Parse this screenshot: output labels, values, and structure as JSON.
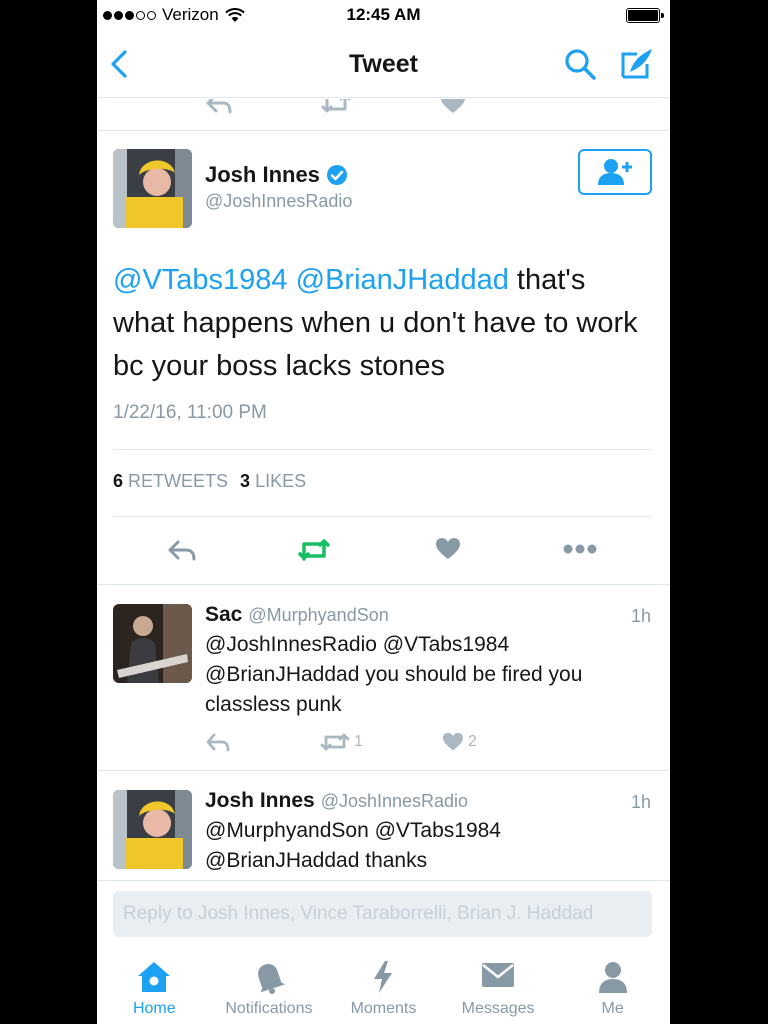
{
  "status_bar": {
    "carrier": "Verizon",
    "time": "12:45 AM"
  },
  "navbar": {
    "title": "Tweet"
  },
  "main_tweet": {
    "name": "Josh Innes",
    "handle": "@JoshInnesRadio",
    "verified": true,
    "mention1": "@VTabs1984",
    "mention2": "@BrianJHaddad",
    "text_rest": " that's what happens when u don't have to work bc your boss lacks stones",
    "timestamp": "1/22/16, 11:00 PM",
    "retweets_count": "6",
    "retweets_label": "RETWEETS",
    "likes_count": "3",
    "likes_label": "LIKES"
  },
  "replies": [
    {
      "name": "Sac",
      "handle": "@MurphyandSon",
      "time": "1h",
      "text": "@JoshInnesRadio @VTabs1984 @BrianJHaddad you should be fired you classless punk",
      "retweets": "1",
      "likes": "2"
    },
    {
      "name": "Josh Innes",
      "handle": "@JoshInnesRadio",
      "time": "1h",
      "text": "@MurphyandSon @VTabs1984 @BrianJHaddad thanks"
    }
  ],
  "composer": {
    "placeholder": "Reply to Josh Innes, Vince Taraborrelli, Brian J. Haddad"
  },
  "tabbar": {
    "home": "Home",
    "notifications": "Notifications",
    "moments": "Moments",
    "messages": "Messages",
    "me": "Me"
  },
  "colors": {
    "accent": "#1da1f2",
    "retweet_active": "#17bf63",
    "muted": "#8899a6"
  }
}
